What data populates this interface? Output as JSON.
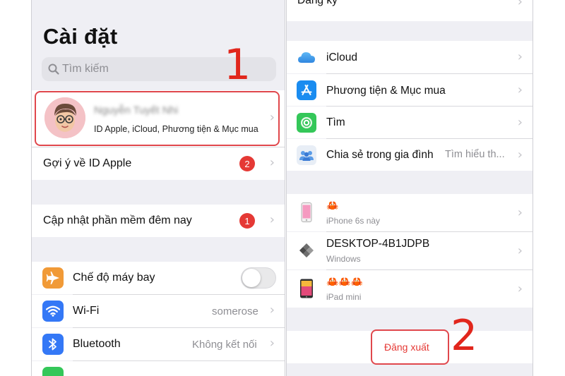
{
  "left": {
    "title": "Cài đặt",
    "search_placeholder": "Tìm kiếm",
    "step_label": "1",
    "profile": {
      "name": "Nguyễn Tuyết Nhi",
      "subtitle": "ID Apple, iCloud, Phương tiện & Mục mua"
    },
    "apple_id_suggestion": {
      "label": "Gợi ý về ID Apple",
      "badge": "2"
    },
    "software_update": {
      "label": "Cập nhật phần mềm đêm nay",
      "badge": "1"
    },
    "settings": [
      {
        "label": "Chế độ máy bay",
        "icon": "airplane-icon",
        "color": "#f19a37"
      },
      {
        "label": "Wi-Fi",
        "value": "somerose",
        "icon": "wifi-icon",
        "color": "#3478f6"
      },
      {
        "label": "Bluetooth",
        "value": "Không kết nối",
        "icon": "bluetooth-icon",
        "color": "#3478f6"
      }
    ],
    "next_row_color": "#34c759"
  },
  "right": {
    "top_partial": "Đăng ký",
    "services": [
      {
        "label": "iCloud",
        "icon": "icloud-icon",
        "color": "#ffffff"
      },
      {
        "label": "Phương tiện & Mục mua",
        "icon": "app-store-icon",
        "color": "#1a8cf0"
      },
      {
        "label": "Tìm",
        "icon": "find-my-icon",
        "color": "#34c759"
      },
      {
        "label": "Chia sẻ trong gia đình",
        "value": "Tìm hiểu th...",
        "icon": "family-sharing-icon",
        "color": "#e8eef6"
      }
    ],
    "devices": [
      {
        "name": "🦀",
        "model": "iPhone 6s này",
        "icon": "iphone-icon"
      },
      {
        "name": "DESKTOP-4B1JDPB",
        "model": "Windows",
        "icon": "windows-icon"
      },
      {
        "name": "🦀🦀🦀",
        "model": "iPad mini",
        "icon": "ipad-icon"
      }
    ],
    "logout_label": "Đăng xuất",
    "step_label": "2"
  },
  "colors": {
    "highlight": "#e0474c",
    "step": "#e1261c",
    "badge": "#e53935"
  }
}
